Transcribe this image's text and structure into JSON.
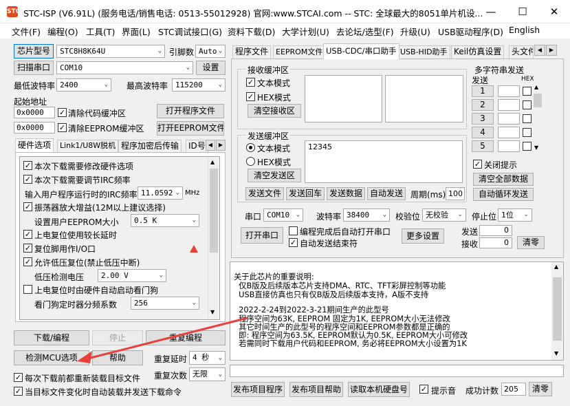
{
  "window": {
    "title": "STC-ISP (V6.91L) (服务电话/销售电话: 0513-55012928) 官网:www.STCAI.com  -- STC: 全球最大的8051单片机设...",
    "icon_text": "STC"
  },
  "menu": [
    "文件(F)",
    "编程(O)",
    "工具(T)",
    "界面(L)",
    "STC调试接口(G)",
    "资料下载(D)",
    "大学计划(U)",
    "去论坛/选型(F)",
    "升级(U)",
    "USB驱动程序(D)",
    "English"
  ],
  "left": {
    "chip_type_btn": "芯片型号",
    "chip_value": "STC8H8K64U",
    "pin_label": "引脚数",
    "pin_value": "Auto",
    "scan_btn": "扫描串口",
    "port_value": "COM10",
    "settings_btn": "设置",
    "min_baud_label": "最低波特率",
    "min_baud": "2400",
    "max_baud_label": "最高波特率",
    "max_baud": "115200",
    "start_addr_label": "起始地址",
    "addr1": "0x0000",
    "clear_code": "清除代码缓冲区",
    "open_prog": "打开程序文件",
    "addr2": "0x0000",
    "clear_eeprom": "清除EEPROM缓冲区",
    "open_eeprom": "打开EEPROM文件",
    "tabs": [
      "硬件选项",
      "Link1/U8W脱机",
      "程序加密后传输",
      "ID号"
    ],
    "options": {
      "o1": "本次下载需要修改硬件选项",
      "o2": "本次下载需要调节IRC频率",
      "irc_label": "输入用户程序运行时的IRC频率",
      "irc_value": "11.0592",
      "irc_unit": "MHz",
      "o3": "振荡器放大增益(12M以上建议选择)",
      "eeprom_size_label": "设置用户EEPROM大小",
      "eeprom_size": "0.5 K",
      "o4": "上电复位使用较长延时",
      "o5": "复位脚用作I/O口",
      "o6": "允许低压复位(禁止低压中断)",
      "lv_label": "低压检测电压",
      "lv_value": "2.00 V",
      "o7": "上电复位时由硬件自动启动看门狗",
      "wdt_label": "看门狗定时器分频系数",
      "wdt_value": "256"
    },
    "download_btn": "下载/编程",
    "stop_btn": "停止",
    "reprog_btn": "重复编程",
    "check_mcu_btn": "检测MCU选项",
    "help_btn": "帮助",
    "repeat_delay_label": "重复延时",
    "repeat_delay": "4 秒",
    "repeat_count_label": "重复次数",
    "repeat_count": "无限",
    "reload_each": "每次下载前都重新装载目标文件",
    "auto_send": "当目标文件变化时自动装载并发送下载命令"
  },
  "right": {
    "tabs": [
      "程序文件",
      "EEPROM文件",
      "USB-CDC/串口助手",
      "USB-HID助手",
      "Keil仿真设置",
      "头文件"
    ],
    "recv_title": "接收缓冲区",
    "recv_text_mode": "文本模式",
    "recv_hex_mode": "HEX模式",
    "clear_recv": "清空接收区",
    "send_title": "发送缓冲区",
    "send_text_mode": "文本模式",
    "send_hex_mode": "HEX模式",
    "clear_send": "清空发送区",
    "send_content": "12345",
    "send_file": "发送文件",
    "send_return": "发送回车",
    "send_data": "发送数据",
    "auto_send_btn": "自动发送",
    "period_label": "周期(ms)",
    "period_value": "100",
    "port_label": "串口",
    "port_value": "COM10",
    "baud_label": "波特率",
    "baud_value": "38400",
    "parity_label": "校验位",
    "parity_value": "无校验",
    "stop_label": "停止位",
    "stop_value": "1位",
    "open_port": "打开串口",
    "auto_open": "编程完成后自动打开串口",
    "auto_end": "自动发送结束符",
    "more_settings": "更多设置",
    "send_count_label": "发送",
    "send_count": "0",
    "recv_count_label": "接收",
    "recv_count": "0",
    "clear_count": "清零",
    "multi_title": "多字符串发送",
    "multi_send_col": "发送",
    "multi_hex_col": "HEX",
    "multi_rows": [
      "1",
      "2",
      "3",
      "4",
      "5"
    ],
    "close_tip": "关闭提示",
    "clear_all": "清空全部数据",
    "auto_loop": "自动循环发送",
    "info_lines": [
      "关于此芯片的重要说明:",
      "  仅B版及后续版本芯片支持DMA、RTC、TFT彩屏控制等功能",
      "  USB直接仿真也只有仅B版及后续版本支持，A版不支持",
      "",
      "  2022-2-24到2022-3-21期间生产的此型号",
      "  程序空间为63K, EEPROM 固定为1K, EEPROM大小无法修改",
      "  其它时间生产的此型号的程序空间和EEPROM参数都是正确的",
      "  即: 程序空间为63.5K, EEPROM默认为0.5K, EEPROM大小可修改",
      "  若需同时下载用户代码和EEPROM, 务必将EEPROM大小设置为1K"
    ],
    "publish_prog": "发布项目程序",
    "publish_help": "发布项目帮助",
    "read_disk": "读取本机硬盘号",
    "tip_sound": "提示音",
    "success_label": "成功计数",
    "success_count": "205",
    "clear_success": "清零"
  },
  "colors": {
    "arrow": "#e8403a",
    "warn_triangle": "#e8403a"
  }
}
